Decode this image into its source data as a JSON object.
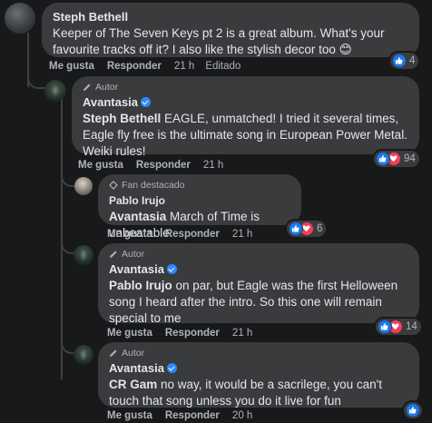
{
  "comments": [
    {
      "author": "Steph Bethell",
      "text": "Keeper of The Seven Keys pt 2 is a great album. What's your favourite tracks off it? I also like the stylish decor too 😊",
      "actions": {
        "like": "Me gusta",
        "reply": "Responder",
        "time": "21 h",
        "edited": "Editado"
      },
      "reactions": {
        "count": "4"
      }
    },
    {
      "badge": "Autor",
      "author": "Avantasia",
      "mention": "Steph Bethell",
      "text": " EAGLE, unmatched! I tried it several times, Eagle fly free is the ultimate song in European Power Metal. Weiki rules!",
      "actions": {
        "like": "Me gusta",
        "reply": "Responder",
        "time": "21 h"
      },
      "reactions": {
        "count": "94"
      }
    },
    {
      "badge": "Fan destacado",
      "author": "Pablo Irujo",
      "mention": "Avantasia",
      "text": " March of Time is unbeatable",
      "actions": {
        "like": "Me gusta",
        "reply": "Responder",
        "time": "21 h"
      },
      "reactions": {
        "count": "6"
      }
    },
    {
      "badge": "Autor",
      "author": "Avantasia",
      "mention": "Pablo Irujo",
      "text": " on par, but Eagle was the first Helloween song I heard after the intro. So this one will remain special to me",
      "actions": {
        "like": "Me gusta",
        "reply": "Responder",
        "time": "21 h"
      },
      "reactions": {
        "count": "14"
      }
    },
    {
      "badge": "Autor",
      "author": "Avantasia",
      "mention": "CR Gam",
      "text": " no way, it would be a sacrilege, you can't touch that song unless you do it live for fun",
      "actions": {
        "like": "Me gusta",
        "reply": "Responder",
        "time": "20 h"
      }
    }
  ],
  "colors": {
    "background": "#18191a",
    "bubble": "#3a3b3c",
    "like": "#1877f2",
    "love": "#f33e58",
    "verified": "#2d88ff"
  }
}
